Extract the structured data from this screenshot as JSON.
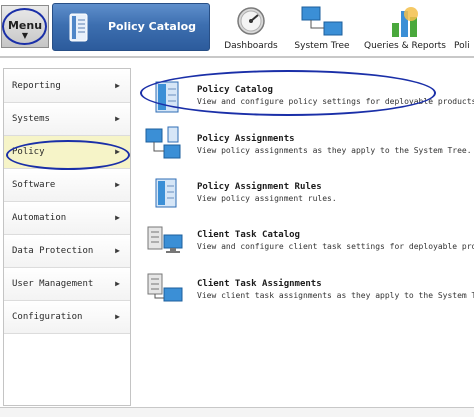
{
  "topbar": {
    "menu_label": "Menu",
    "active_tab_label": "Policy Catalog",
    "quick_tabs": [
      {
        "label": "Dashboards",
        "icon": "gauge-icon"
      },
      {
        "label": "System Tree",
        "icon": "system-tree-icon"
      },
      {
        "label": "Queries & Reports",
        "icon": "bar-chart-icon"
      },
      {
        "label": "Poli",
        "icon": "policy-icon"
      }
    ]
  },
  "sidebar": {
    "items": [
      {
        "label": "Reporting"
      },
      {
        "label": "Systems"
      },
      {
        "label": "Policy",
        "selected": true
      },
      {
        "label": "Software"
      },
      {
        "label": "Automation"
      },
      {
        "label": "Data Protection"
      },
      {
        "label": "User Management"
      },
      {
        "label": "Configuration"
      }
    ]
  },
  "main": {
    "items": [
      {
        "title": "Policy Catalog",
        "description": "View and configure policy settings for deployable products.",
        "icon": "policy-catalog-icon"
      },
      {
        "title": "Policy Assignments",
        "description": "View policy assignments as they apply to the System Tree.",
        "icon": "policy-assignments-icon"
      },
      {
        "title": "Policy Assignment Rules",
        "description": "View policy assignment rules.",
        "icon": "policy-rules-icon"
      },
      {
        "title": "Client Task Catalog",
        "description": "View and configure client task settings for deployable products.",
        "icon": "client-task-catalog-icon"
      },
      {
        "title": "Client Task Assignments",
        "description": "View client task assignments as they apply to the System Tree.",
        "icon": "client-task-assignments-icon"
      }
    ]
  },
  "colors": {
    "tab_blue": "#3d6fb0",
    "highlight_ellipse": "#1a2fa8",
    "selected_item": "#f6f4c8"
  }
}
